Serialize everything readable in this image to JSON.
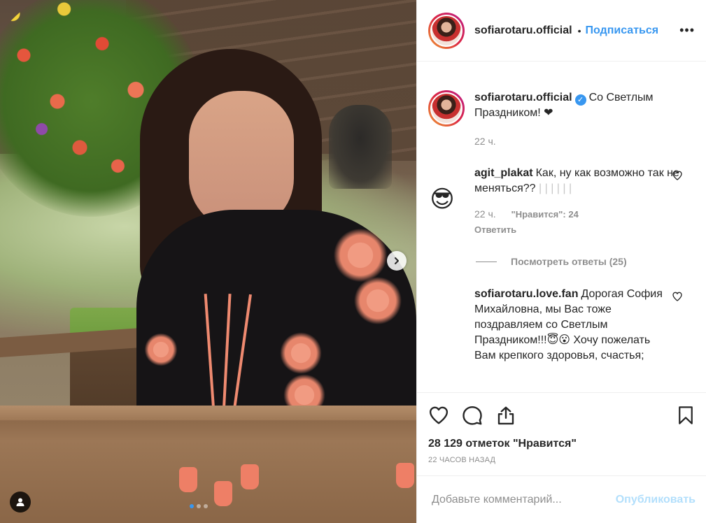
{
  "header": {
    "username": "sofiarotaru.official",
    "separator": "•",
    "follow_label": "Подписаться",
    "more_label": "•••"
  },
  "caption": {
    "username": "sofiarotaru.official",
    "verified_mark": "✓",
    "text": "Со Светлым Праздником! ❤",
    "time": "22 ч."
  },
  "comments": [
    {
      "username": "agit_plakat",
      "text": "Как, ну как возможно так не меняться??",
      "faded": "| | | | | |",
      "time": "22 ч.",
      "likes": "\"Нравится\": 24",
      "reply_label": "Ответить",
      "avatar_icon": "sunglasses-face-icon",
      "avatar_glyph": "😎"
    },
    {
      "username": "sofiarotaru.love.fan",
      "text": "Дорогая София Михайловна, мы Вас тоже поздравляем со Светлым Праздником!!!😇😮 Хочу пожелать Вам крепкого здоровья, счастья;"
    }
  ],
  "view_replies_label": "Посмотреть ответы (25)",
  "post": {
    "likes_text": "28 129 отметок \"Нравится\"",
    "time_ago": "22 ЧАСОВ НАЗАД"
  },
  "comment_box": {
    "placeholder": "Добавьте комментарий...",
    "publish_label": "Опубликовать"
  },
  "carousel": {
    "total_slides": 3,
    "active_index": 0
  },
  "colors": {
    "accent": "#3897f0",
    "publish_disabled": "#b2dffc",
    "muted": "#8e8e8e",
    "text": "#262626"
  },
  "icons": {
    "like": "heart-outline-icon",
    "comment": "comment-bubble-icon",
    "share": "share-icon",
    "save": "bookmark-icon",
    "next": "chevron-right-icon",
    "user_tag": "user-tag-icon"
  }
}
